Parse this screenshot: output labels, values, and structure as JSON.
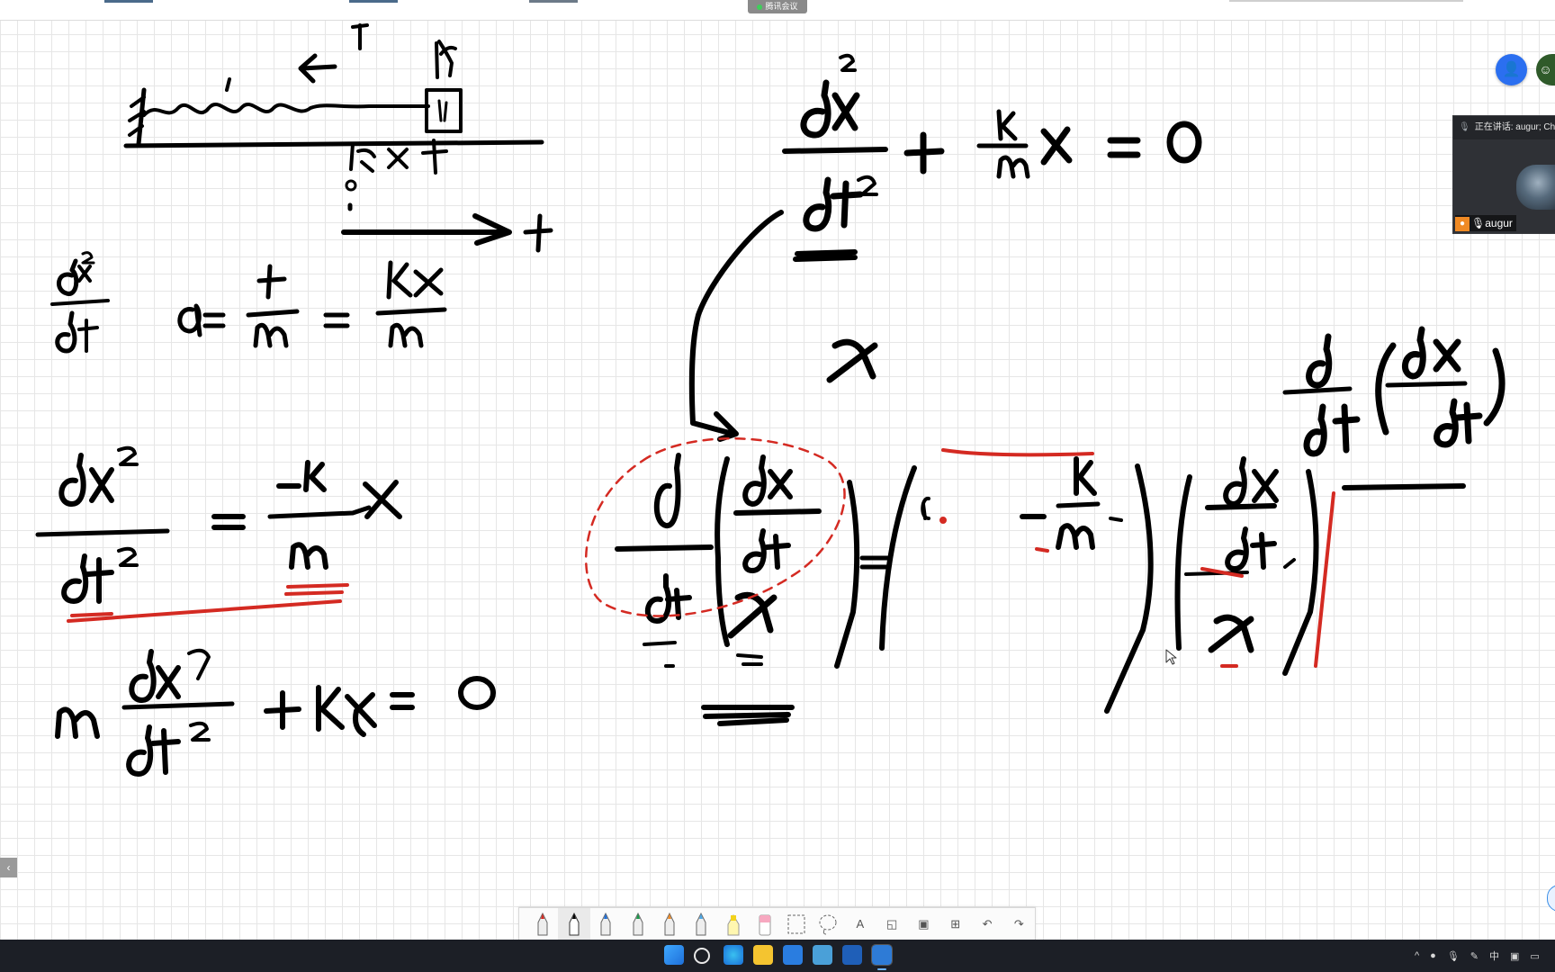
{
  "app": {
    "meeting_badge": "腾讯会议"
  },
  "speaker_panel": {
    "status": "正在讲话: augur; Ch",
    "name": "augur"
  },
  "whiteboard": {
    "description_labels": {
      "spring_mass": "spring-mass diagram",
      "equations": "handwritten equations"
    }
  },
  "toolbar": {
    "tools": [
      {
        "name": "red-pen-tool",
        "glyph": "✎"
      },
      {
        "name": "black-pen-tool",
        "glyph": "✎"
      },
      {
        "name": "blue-pen-tool",
        "glyph": "✎"
      },
      {
        "name": "green-pen-tool",
        "glyph": "✎"
      },
      {
        "name": "orange-pen-tool",
        "glyph": "✎"
      },
      {
        "name": "lightblue-pen-tool",
        "glyph": "✎"
      },
      {
        "name": "highlighter-tool",
        "glyph": "▮"
      },
      {
        "name": "eraser-tool",
        "glyph": "▭"
      },
      {
        "name": "ruler-tool",
        "glyph": "▦"
      },
      {
        "name": "lasso-tool",
        "glyph": "◌"
      },
      {
        "name": "text-tool",
        "glyph": "A"
      },
      {
        "name": "shape-tool",
        "glyph": "◱"
      },
      {
        "name": "image-tool",
        "glyph": "▣"
      },
      {
        "name": "insert-tool",
        "glyph": "⊞"
      },
      {
        "name": "undo-tool",
        "glyph": "↶"
      },
      {
        "name": "redo-tool",
        "glyph": "↷"
      }
    ]
  },
  "taskbar": {
    "tray_ime": "中"
  },
  "colors": {
    "ink": "#000000",
    "red_ink": "#d42a22",
    "accent": "#2b6ff0",
    "taskbar": "#1c1f26"
  }
}
